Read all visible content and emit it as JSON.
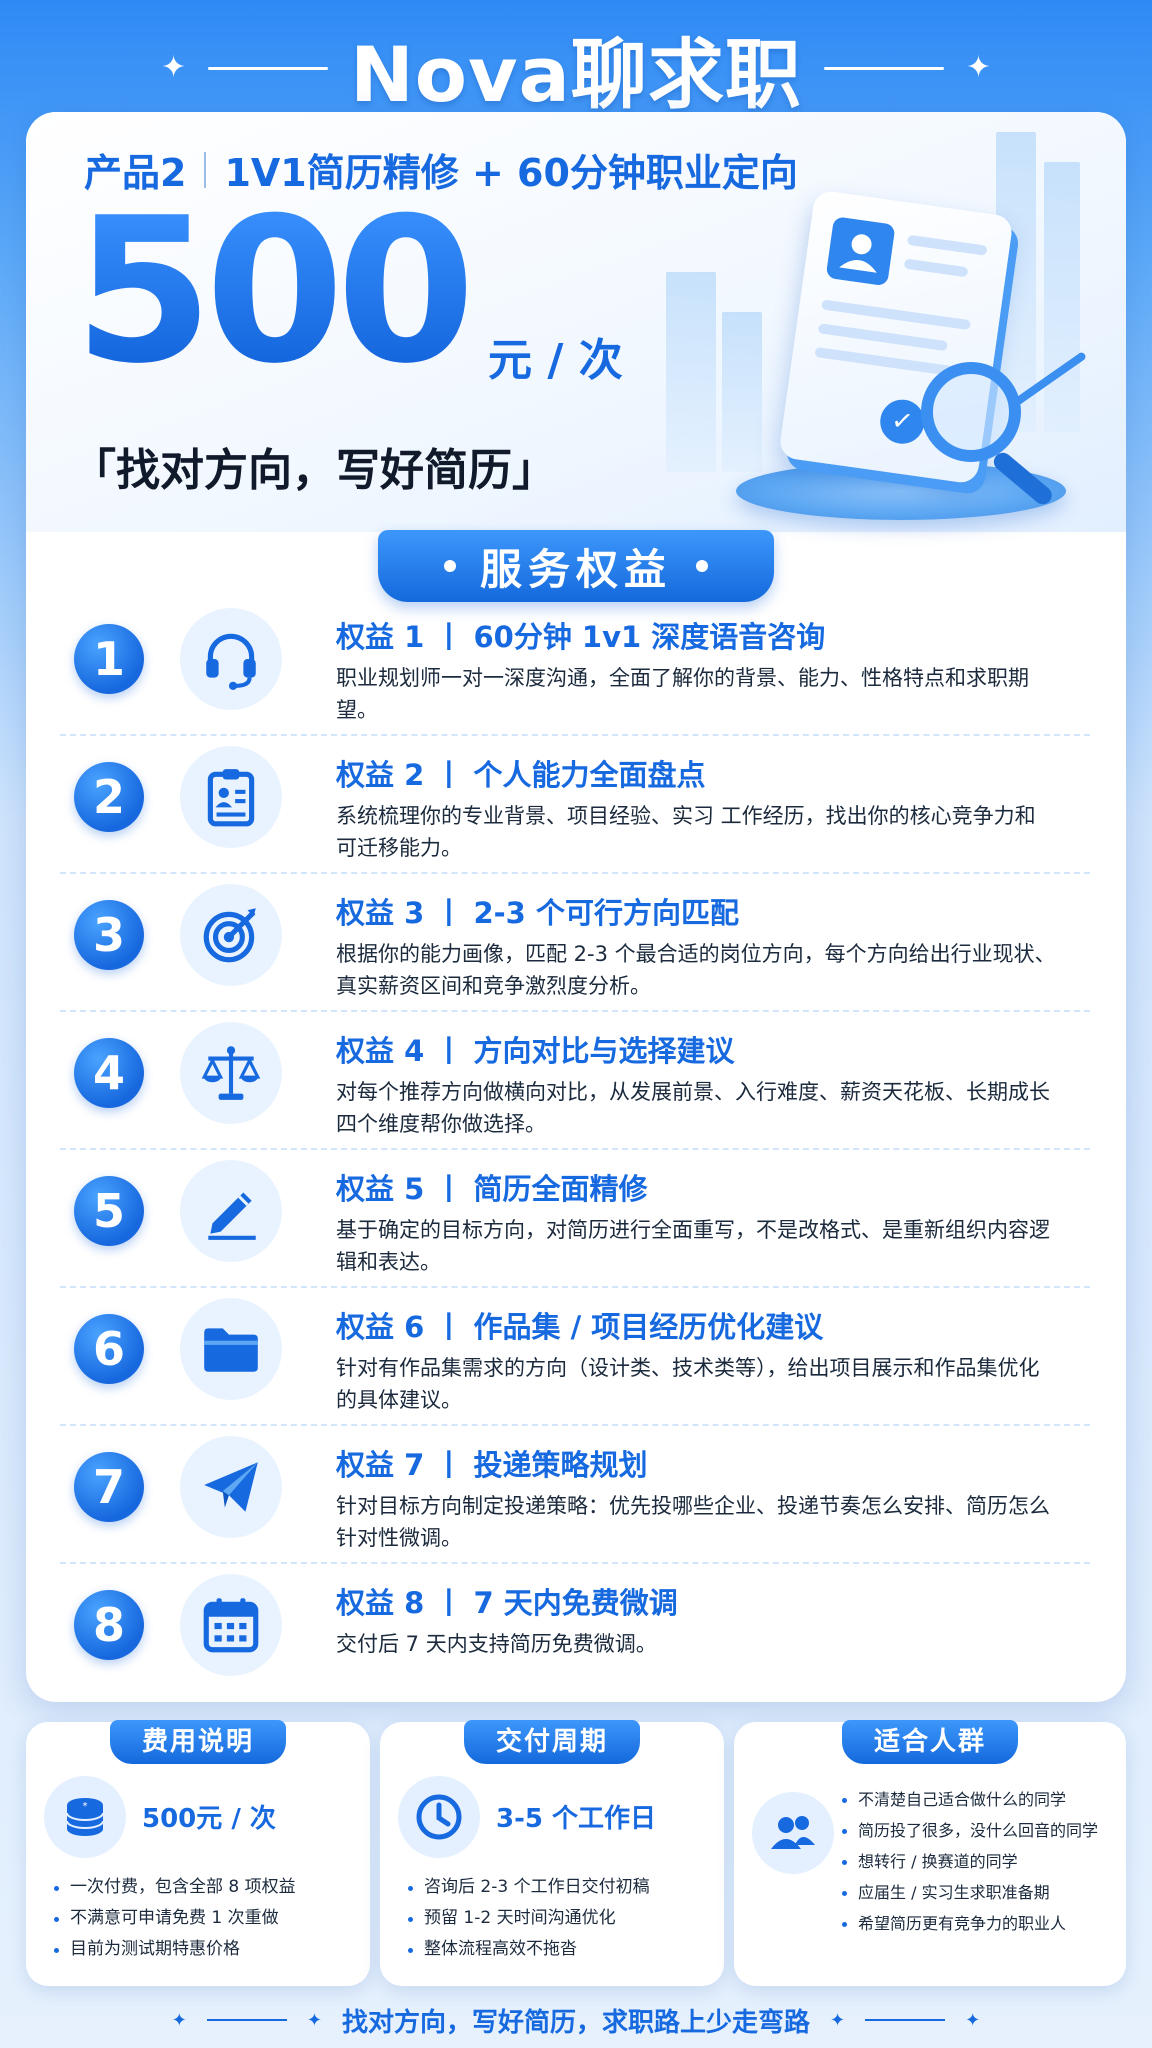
{
  "header": {
    "title": "Nova聊求职"
  },
  "hero": {
    "product_label": "产品2",
    "product_desc": "1V1简历精修 + 60分钟职业定向",
    "price": "500",
    "price_unit": "元 / 次",
    "slogan": "「找对方向，写好简历」"
  },
  "service": {
    "banner": "服务权益"
  },
  "benefits": [
    {
      "num": "1",
      "icon": "headset-icon",
      "title": "权益 1 丨 60分钟 1v1 深度语音咨询",
      "desc": "职业规划师一对一深度沟通，全面了解你的背景、能力、性格特点和求职期望。"
    },
    {
      "num": "2",
      "icon": "clipboard-profile-icon",
      "title": "权益 2 丨 个人能力全面盘点",
      "desc": "系统梳理你的专业背景、项目经验、实习 工作经历，找出你的核心竞争力和可迁移能力。"
    },
    {
      "num": "3",
      "icon": "target-icon",
      "title": "权益 3 丨 2-3 个可行方向匹配",
      "desc": "根据你的能力画像，匹配 2-3 个最合适的岗位方向，每个方向给出行业现状、真实薪资区间和竞争激烈度分析。"
    },
    {
      "num": "4",
      "icon": "scale-icon",
      "title": "权益 4 丨 方向对比与选择建议",
      "desc": "对每个推荐方向做横向对比，从发展前景、入行难度、薪资天花板、长期成长 四个维度帮你做选择。"
    },
    {
      "num": "5",
      "icon": "pencil-icon",
      "title": "权益 5 丨 简历全面精修",
      "desc": "基于确定的目标方向，对简历进行全面重写，不是改格式、是重新组织内容逻辑和表达。"
    },
    {
      "num": "6",
      "icon": "folder-icon",
      "title": "权益 6 丨 作品集 / 项目经历优化建议",
      "desc": "针对有作品集需求的方向（设计类、技术类等），给出项目展示和作品集优化的具体建议。"
    },
    {
      "num": "7",
      "icon": "paper-plane-icon",
      "title": "权益 7 丨 投递策略规划",
      "desc": "针对目标方向制定投递策略：优先投哪些企业、投递节奏怎么安排、简历怎么针对性微调。"
    },
    {
      "num": "8",
      "icon": "calendar-icon",
      "title": "权益 8 丨 7 天内免费微调",
      "desc": "交付后 7 天内支持简历免费微调。"
    }
  ],
  "cards": {
    "fee": {
      "tag": "费用说明",
      "icon": "coin-stack-icon",
      "headline": "500元 / 次",
      "items": [
        "一次付费，包含全部 8 项权益",
        "不满意可申请免费 1 次重做",
        "目前为测试期特惠价格"
      ]
    },
    "delivery": {
      "tag": "交付周期",
      "icon": "clock-icon",
      "headline": "3-5 个工作日",
      "items": [
        "咨询后 2-3 个工作日交付初稿",
        "预留 1-2 天时间沟通优化",
        "整体流程高效不拖沓"
      ]
    },
    "audience": {
      "tag": "适合人群",
      "icon": "people-icon",
      "items": [
        "不清楚自己适合做什么的同学",
        "简历投了很多，没什么回音的同学",
        "想转行 / 换赛道的同学",
        "应届生 / 实习生求职准备期",
        "希望简历更有竞争力的职业人"
      ]
    }
  },
  "footer": {
    "text": "找对方向，写好简历，求职路上少走弯路"
  },
  "colors": {
    "brand_blue": "#1769e0",
    "light_blue": "#e9f3ff",
    "background_top": "#2f8af5"
  }
}
